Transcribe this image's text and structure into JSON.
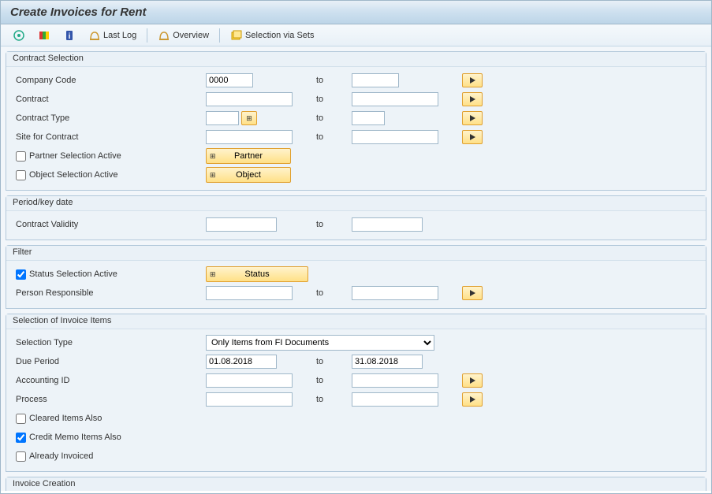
{
  "title": "Create Invoices for Rent",
  "toolbar": {
    "last_log": "Last Log",
    "overview": "Overview",
    "sel_sets": "Selection via Sets"
  },
  "contract_sel": {
    "title": "Contract Selection",
    "company_code_label": "Company Code",
    "company_code_value": "0000",
    "contract_label": "Contract",
    "contract_type_label": "Contract Type",
    "site_label": "Site for Contract",
    "partner_sel_label": "Partner Selection Active",
    "object_sel_label": "Object Selection Active",
    "partner_btn": "Partner",
    "object_btn": "Object",
    "to": "to"
  },
  "period": {
    "title": "Period/key date",
    "validity_label": "Contract Validity",
    "to": "to"
  },
  "filter": {
    "title": "Filter",
    "status_active_label": "Status Selection Active",
    "status_btn": "Status",
    "person_resp_label": "Person Responsible",
    "to": "to"
  },
  "inv_items": {
    "title": "Selection of Invoice Items",
    "sel_type_label": "Selection Type",
    "sel_type_value": "Only Items from FI Documents",
    "due_period_label": "Due Period",
    "due_from": "01.08.2018",
    "due_to": "31.08.2018",
    "acct_id_label": "Accounting ID",
    "process_label": "Process",
    "cleared_label": "Cleared Items Also",
    "credit_memo_label": "Credit Memo Items Also",
    "already_inv_label": "Already Invoiced",
    "to": "to"
  },
  "inv_creation": {
    "title": "Invoice Creation"
  }
}
